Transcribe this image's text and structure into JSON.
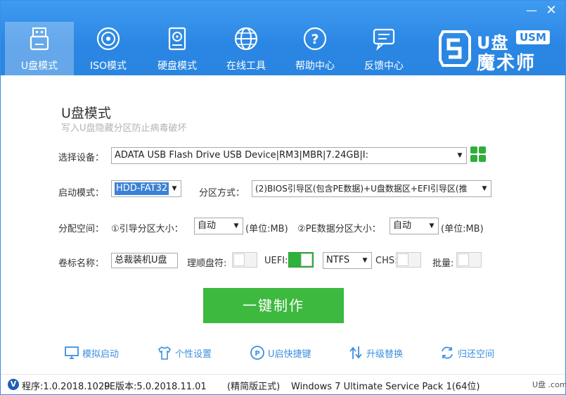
{
  "window": {
    "minimize_glyph": "—",
    "close_glyph": "✕"
  },
  "nav": [
    {
      "label": "U盘模式",
      "icon": "usb-drive-icon",
      "active": true
    },
    {
      "label": "ISO模式",
      "icon": "disc-icon",
      "active": false
    },
    {
      "label": "硬盘模式",
      "icon": "hard-disk-icon",
      "active": false
    },
    {
      "label": "在线工具",
      "icon": "globe-icon",
      "active": false
    },
    {
      "label": "帮助中心",
      "icon": "help-icon",
      "active": false
    },
    {
      "label": "反馈中心",
      "icon": "feedback-icon",
      "active": false
    }
  ],
  "logo": {
    "line1": "U盘",
    "badge": "USM",
    "line2": "魔术师"
  },
  "section": {
    "title": "U盘模式",
    "subtitle": "写入U盘隐藏分区防止病毒破坏"
  },
  "form": {
    "device_label": "选择设备：",
    "device_value": "ADATA USB Flash Drive USB Device|RM3|MBR|7.24GB|I:",
    "boot_mode_label": "启动模式：",
    "boot_mode_value": "HDD-FAT32",
    "partition_method_label": "分区方式：",
    "partition_method_value": "(2)BIOS引导区(包含PE数据)+U盘数据区+EFI引导区(推",
    "alloc_label": "分配空间：",
    "boot_size_label": "①引导分区大小：",
    "boot_size_value": "自动",
    "boot_size_unit": "(单位:MB)",
    "pe_size_label": "②PE数据分区大小：",
    "pe_size_value": "自动",
    "pe_size_unit": "(单位:MB)",
    "volume_label": "卷标名称：",
    "volume_value": "总裁装机U盘",
    "defrag_label": "理顺盘符:",
    "defrag_on": false,
    "uefi_label": "UEFI:",
    "uefi_on": true,
    "fs_value": "NTFS",
    "chs_label": "CHS:",
    "chs_on": false,
    "batch_label": "批量:",
    "batch_on": false
  },
  "make_button": "一键制作",
  "tools": [
    {
      "label": "模拟启动",
      "icon": "monitor-icon"
    },
    {
      "label": "个性设置",
      "icon": "tshirt-icon"
    },
    {
      "label": "U启快捷键",
      "icon": "shortcut-key-icon"
    },
    {
      "label": "升级替换",
      "icon": "upgrade-icon"
    },
    {
      "label": "归还空间",
      "icon": "restore-icon"
    }
  ],
  "status": {
    "badge": "V",
    "program_version": "程序:1.0.2018.1029",
    "pe_version": "PE版本:5.0.2018.11.01",
    "edition": "(精简版正式)",
    "os": "Windows 7 Ultimate Service Pack 1(64位)",
    "watermark": "U盘 .com"
  },
  "colors": {
    "header": "#2a86e3",
    "accent_green": "#3cb93e",
    "link_blue": "#3d8fe0"
  }
}
